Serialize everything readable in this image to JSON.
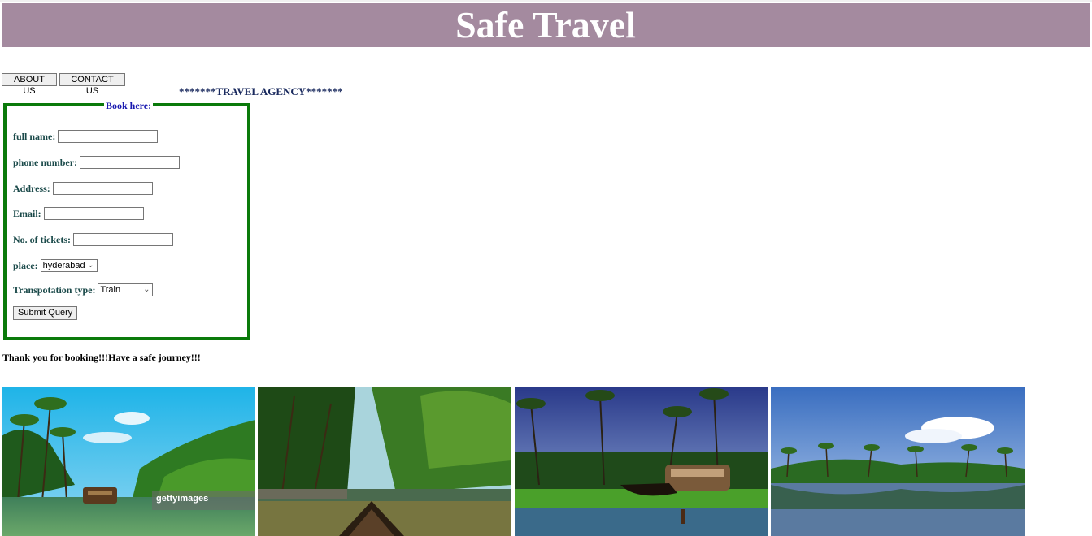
{
  "header": {
    "title": "Safe Travel"
  },
  "nav": {
    "about_label": "ABOUT US",
    "contact_label": "CONTACT US"
  },
  "agency_text": "*******TRAVEL AGENCY*******",
  "form": {
    "legend": "Book here:",
    "fields": [
      {
        "label": "full name:",
        "value": ""
      },
      {
        "label": "phone number:",
        "value": ""
      },
      {
        "label": "Address:",
        "value": ""
      },
      {
        "label": "Email:",
        "value": ""
      },
      {
        "label": "No. of tickets:",
        "value": ""
      }
    ],
    "place": {
      "label": "place:",
      "selected": "hyderabad"
    },
    "transport": {
      "label": "Transpotation type:",
      "selected": "Train"
    },
    "submit_label": "Submit Query"
  },
  "thanks_text": "Thank you for booking!!!Have a safe journey!!!",
  "gallery": [
    {
      "name": "houseboat-backwaters-photo",
      "watermark": "gettyimages"
    },
    {
      "name": "canoe-backwaters-photo"
    },
    {
      "name": "houseboat-palms-photo"
    },
    {
      "name": "lake-palms-reflection-photo"
    }
  ],
  "colors": {
    "banner": "#a48a9f",
    "form_border": "#0a7a0a",
    "legend": "#1a1ab0"
  }
}
